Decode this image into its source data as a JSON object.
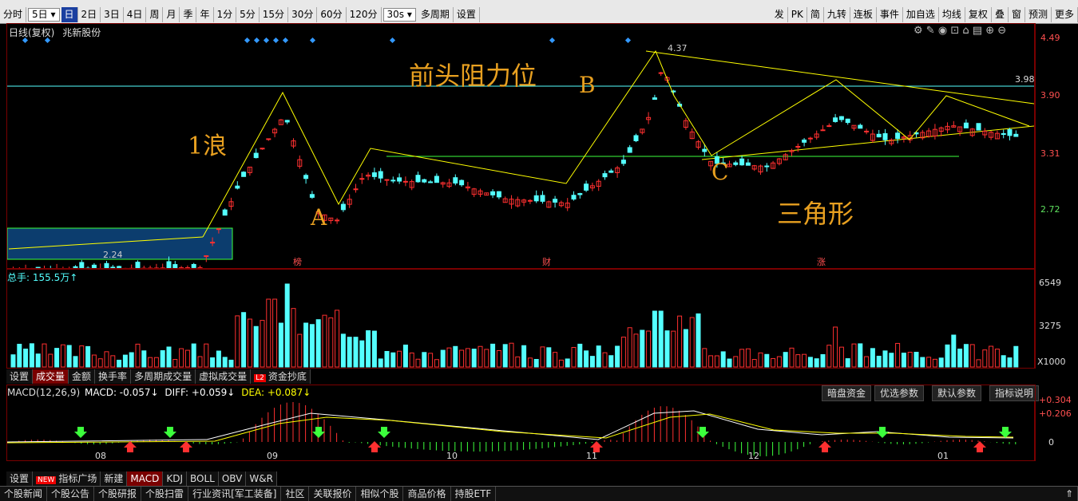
{
  "toolbar": {
    "items": [
      "分时",
      "5日",
      "日",
      "2日",
      "3日",
      "4日",
      "周",
      "月",
      "季",
      "年",
      "1分",
      "5分",
      "15分",
      "30分",
      "60分",
      "120分",
      "30s",
      "多周期",
      "设置"
    ],
    "period_select": "5日",
    "sec_select": "30s",
    "active": "日",
    "right_items": [
      "发",
      "PK",
      "简",
      "九转",
      "连板",
      "事件",
      "加自选",
      "均线",
      "复权",
      "叠",
      "窗",
      "预测",
      "更多"
    ]
  },
  "kline": {
    "title": "日线(复权)",
    "stock": "兆新股份",
    "price_ticks": [
      "4.49",
      "3.90",
      "3.31",
      "2.72"
    ],
    "resistance_label": "3.98",
    "high_label": "4.37",
    "low_label": "2.24",
    "month_markers": [
      "榜",
      "财",
      "涨"
    ]
  },
  "annotations": {
    "wave1": "1浪",
    "resistance": "前头阻力位",
    "point_a": "A",
    "point_b": "B",
    "point_c": "C",
    "triangle": "三角形"
  },
  "volume": {
    "label": "总手: 155.5万↑",
    "ticks": [
      "6549",
      "3275",
      "X1000"
    ]
  },
  "tabs": [
    "设置",
    "成交量",
    "金额",
    "换手率",
    "多周期成交量",
    "虚拟成交量",
    "资金抄底"
  ],
  "tab_badge": "L2",
  "active_tab": "成交量",
  "macd": {
    "label": "MACD(12,26,9)",
    "macd_value": "MACD: -0.057↓",
    "diff_value": "DIFF: +0.059↓",
    "dea_value": "DEA: +0.087↓",
    "ticks": [
      "+0.304",
      "+0.206",
      "0"
    ],
    "buttons": [
      "暗盘资金",
      "优选参数",
      "默认参数",
      "指标说明"
    ],
    "months": [
      "08",
      "09",
      "10",
      "11",
      "12",
      "01"
    ]
  },
  "indicator_tabs": [
    "设置",
    "指标广场",
    "新建",
    "MACD",
    "KDJ",
    "BOLL",
    "OBV",
    "W&R"
  ],
  "new_badge": "NEW",
  "active_indicator": "MACD",
  "bottom_tabs": [
    "个股新闻",
    "个股公告",
    "个股研报",
    "个股扫雷",
    "行业资讯[军工装备]",
    "社区",
    "关联报价",
    "相似个股",
    "商品价格",
    "持股ETF"
  ],
  "colors": {
    "up": "#ff3030",
    "down": "#54ffff",
    "ma": "#ffff00",
    "trend": "#00ff00",
    "accent": "#e8a020"
  }
}
